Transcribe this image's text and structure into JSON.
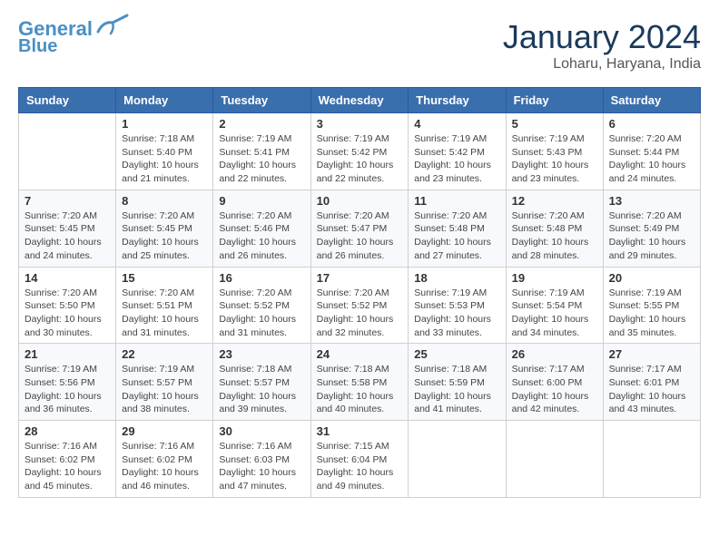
{
  "header": {
    "logo_line1": "General",
    "logo_line2": "Blue",
    "month": "January 2024",
    "location": "Loharu, Haryana, India"
  },
  "days_of_week": [
    "Sunday",
    "Monday",
    "Tuesday",
    "Wednesday",
    "Thursday",
    "Friday",
    "Saturday"
  ],
  "weeks": [
    [
      {
        "day": "",
        "info": ""
      },
      {
        "day": "1",
        "info": "Sunrise: 7:18 AM\nSunset: 5:40 PM\nDaylight: 10 hours\nand 21 minutes."
      },
      {
        "day": "2",
        "info": "Sunrise: 7:19 AM\nSunset: 5:41 PM\nDaylight: 10 hours\nand 22 minutes."
      },
      {
        "day": "3",
        "info": "Sunrise: 7:19 AM\nSunset: 5:42 PM\nDaylight: 10 hours\nand 22 minutes."
      },
      {
        "day": "4",
        "info": "Sunrise: 7:19 AM\nSunset: 5:42 PM\nDaylight: 10 hours\nand 23 minutes."
      },
      {
        "day": "5",
        "info": "Sunrise: 7:19 AM\nSunset: 5:43 PM\nDaylight: 10 hours\nand 23 minutes."
      },
      {
        "day": "6",
        "info": "Sunrise: 7:20 AM\nSunset: 5:44 PM\nDaylight: 10 hours\nand 24 minutes."
      }
    ],
    [
      {
        "day": "7",
        "info": "Sunrise: 7:20 AM\nSunset: 5:45 PM\nDaylight: 10 hours\nand 24 minutes."
      },
      {
        "day": "8",
        "info": "Sunrise: 7:20 AM\nSunset: 5:45 PM\nDaylight: 10 hours\nand 25 minutes."
      },
      {
        "day": "9",
        "info": "Sunrise: 7:20 AM\nSunset: 5:46 PM\nDaylight: 10 hours\nand 26 minutes."
      },
      {
        "day": "10",
        "info": "Sunrise: 7:20 AM\nSunset: 5:47 PM\nDaylight: 10 hours\nand 26 minutes."
      },
      {
        "day": "11",
        "info": "Sunrise: 7:20 AM\nSunset: 5:48 PM\nDaylight: 10 hours\nand 27 minutes."
      },
      {
        "day": "12",
        "info": "Sunrise: 7:20 AM\nSunset: 5:48 PM\nDaylight: 10 hours\nand 28 minutes."
      },
      {
        "day": "13",
        "info": "Sunrise: 7:20 AM\nSunset: 5:49 PM\nDaylight: 10 hours\nand 29 minutes."
      }
    ],
    [
      {
        "day": "14",
        "info": "Sunrise: 7:20 AM\nSunset: 5:50 PM\nDaylight: 10 hours\nand 30 minutes."
      },
      {
        "day": "15",
        "info": "Sunrise: 7:20 AM\nSunset: 5:51 PM\nDaylight: 10 hours\nand 31 minutes."
      },
      {
        "day": "16",
        "info": "Sunrise: 7:20 AM\nSunset: 5:52 PM\nDaylight: 10 hours\nand 31 minutes."
      },
      {
        "day": "17",
        "info": "Sunrise: 7:20 AM\nSunset: 5:52 PM\nDaylight: 10 hours\nand 32 minutes."
      },
      {
        "day": "18",
        "info": "Sunrise: 7:19 AM\nSunset: 5:53 PM\nDaylight: 10 hours\nand 33 minutes."
      },
      {
        "day": "19",
        "info": "Sunrise: 7:19 AM\nSunset: 5:54 PM\nDaylight: 10 hours\nand 34 minutes."
      },
      {
        "day": "20",
        "info": "Sunrise: 7:19 AM\nSunset: 5:55 PM\nDaylight: 10 hours\nand 35 minutes."
      }
    ],
    [
      {
        "day": "21",
        "info": "Sunrise: 7:19 AM\nSunset: 5:56 PM\nDaylight: 10 hours\nand 36 minutes."
      },
      {
        "day": "22",
        "info": "Sunrise: 7:19 AM\nSunset: 5:57 PM\nDaylight: 10 hours\nand 38 minutes."
      },
      {
        "day": "23",
        "info": "Sunrise: 7:18 AM\nSunset: 5:57 PM\nDaylight: 10 hours\nand 39 minutes."
      },
      {
        "day": "24",
        "info": "Sunrise: 7:18 AM\nSunset: 5:58 PM\nDaylight: 10 hours\nand 40 minutes."
      },
      {
        "day": "25",
        "info": "Sunrise: 7:18 AM\nSunset: 5:59 PM\nDaylight: 10 hours\nand 41 minutes."
      },
      {
        "day": "26",
        "info": "Sunrise: 7:17 AM\nSunset: 6:00 PM\nDaylight: 10 hours\nand 42 minutes."
      },
      {
        "day": "27",
        "info": "Sunrise: 7:17 AM\nSunset: 6:01 PM\nDaylight: 10 hours\nand 43 minutes."
      }
    ],
    [
      {
        "day": "28",
        "info": "Sunrise: 7:16 AM\nSunset: 6:02 PM\nDaylight: 10 hours\nand 45 minutes."
      },
      {
        "day": "29",
        "info": "Sunrise: 7:16 AM\nSunset: 6:02 PM\nDaylight: 10 hours\nand 46 minutes."
      },
      {
        "day": "30",
        "info": "Sunrise: 7:16 AM\nSunset: 6:03 PM\nDaylight: 10 hours\nand 47 minutes."
      },
      {
        "day": "31",
        "info": "Sunrise: 7:15 AM\nSunset: 6:04 PM\nDaylight: 10 hours\nand 49 minutes."
      },
      {
        "day": "",
        "info": ""
      },
      {
        "day": "",
        "info": ""
      },
      {
        "day": "",
        "info": ""
      }
    ]
  ]
}
